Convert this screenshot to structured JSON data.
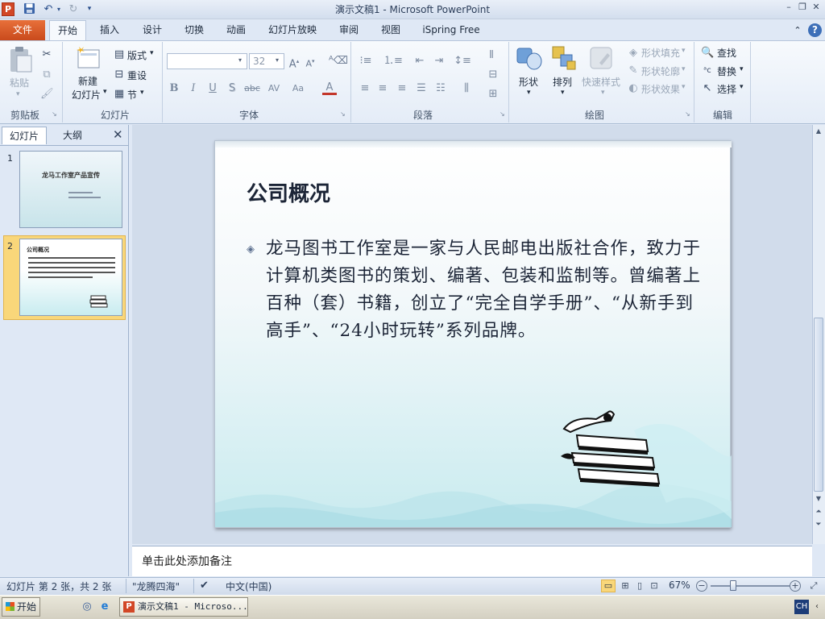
{
  "window": {
    "title": "演示文稿1 - Microsoft PowerPoint",
    "app_icon": "P"
  },
  "quick_access": [
    "save-icon",
    "undo-icon",
    "redo-icon",
    "customize-icon"
  ],
  "tabs": [
    {
      "label": "文件",
      "active": false
    },
    {
      "label": "开始",
      "active": true
    },
    {
      "label": "插入",
      "active": false
    },
    {
      "label": "设计",
      "active": false
    },
    {
      "label": "切换",
      "active": false
    },
    {
      "label": "动画",
      "active": false
    },
    {
      "label": "幻灯片放映",
      "active": false
    },
    {
      "label": "审阅",
      "active": false
    },
    {
      "label": "视图",
      "active": false
    },
    {
      "label": "iSpring Free",
      "active": false
    }
  ],
  "ribbon": {
    "clipboard": {
      "group": "剪贴板",
      "paste": "粘贴"
    },
    "slides": {
      "group": "幻灯片",
      "new_line1": "新建",
      "new_line2": "幻灯片",
      "layout": "版式",
      "reset": "重设",
      "section": "节"
    },
    "font": {
      "group": "字体",
      "font_name": "",
      "font_size": "32",
      "bold": "B",
      "italic": "I",
      "underline": "U",
      "shadow": "S",
      "strike": "abc",
      "spacing": "AV",
      "case": "Aa",
      "color": "A"
    },
    "paragraph": {
      "group": "段落"
    },
    "drawing": {
      "group": "绘图",
      "shapes": "形状",
      "arrange": "排列",
      "quick_styles": "快速样式",
      "fill": "形状填充",
      "outline": "形状轮廓",
      "effects": "形状效果"
    },
    "editing": {
      "group": "编辑",
      "find": "查找",
      "replace": "替换",
      "select": "选择"
    }
  },
  "left_pane": {
    "tabs": [
      "幻灯片",
      "大纲"
    ],
    "slides": [
      {
        "number": "1",
        "title": "龙马工作室产品宣传",
        "selected": false
      },
      {
        "number": "2",
        "title": "公司概况",
        "selected": true
      }
    ]
  },
  "slide": {
    "title": "公司概况",
    "body": "龙马图书工作室是一家与人民邮电出版社合作，致力于计算机类图书的策划、编著、包装和监制等。曾编著上百种（套）书籍，创立了“完全自学手册”、“从新手到高手”、“24小时玩转”系列品牌。"
  },
  "notes": {
    "placeholder": "单击此处添加备注"
  },
  "status": {
    "slide_info": "幻灯片 第 2 张，共 2 张",
    "theme": "\"龙腾四海\"",
    "language": "中文(中国)",
    "zoom": "67%",
    "zoom_level": 0.67
  },
  "taskbar": {
    "start": "开始",
    "task": "演示文稿1 - Microso...",
    "ime": "CH"
  },
  "colors": {
    "file_tab": "#d24726",
    "selected_thumb": "#f9d77a",
    "accent": "#2b579a"
  }
}
